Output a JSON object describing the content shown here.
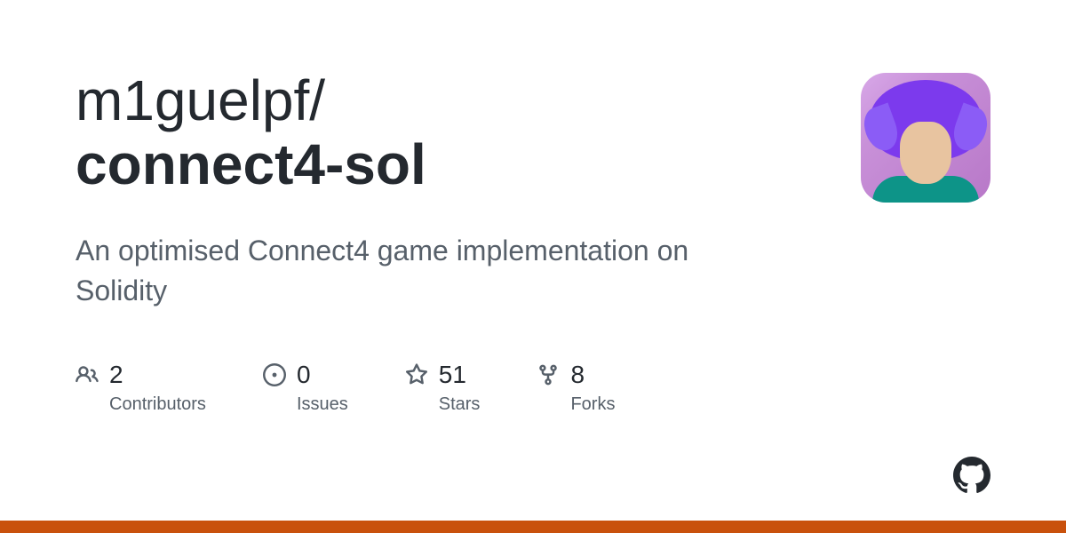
{
  "owner": "m1guelpf/",
  "repo": "connect4-sol",
  "description": "An optimised Connect4 game implementation on Solidity",
  "stats": {
    "contributors": {
      "value": "2",
      "label": "Contributors"
    },
    "issues": {
      "value": "0",
      "label": "Issues"
    },
    "stars": {
      "value": "51",
      "label": "Stars"
    },
    "forks": {
      "value": "8",
      "label": "Forks"
    }
  }
}
